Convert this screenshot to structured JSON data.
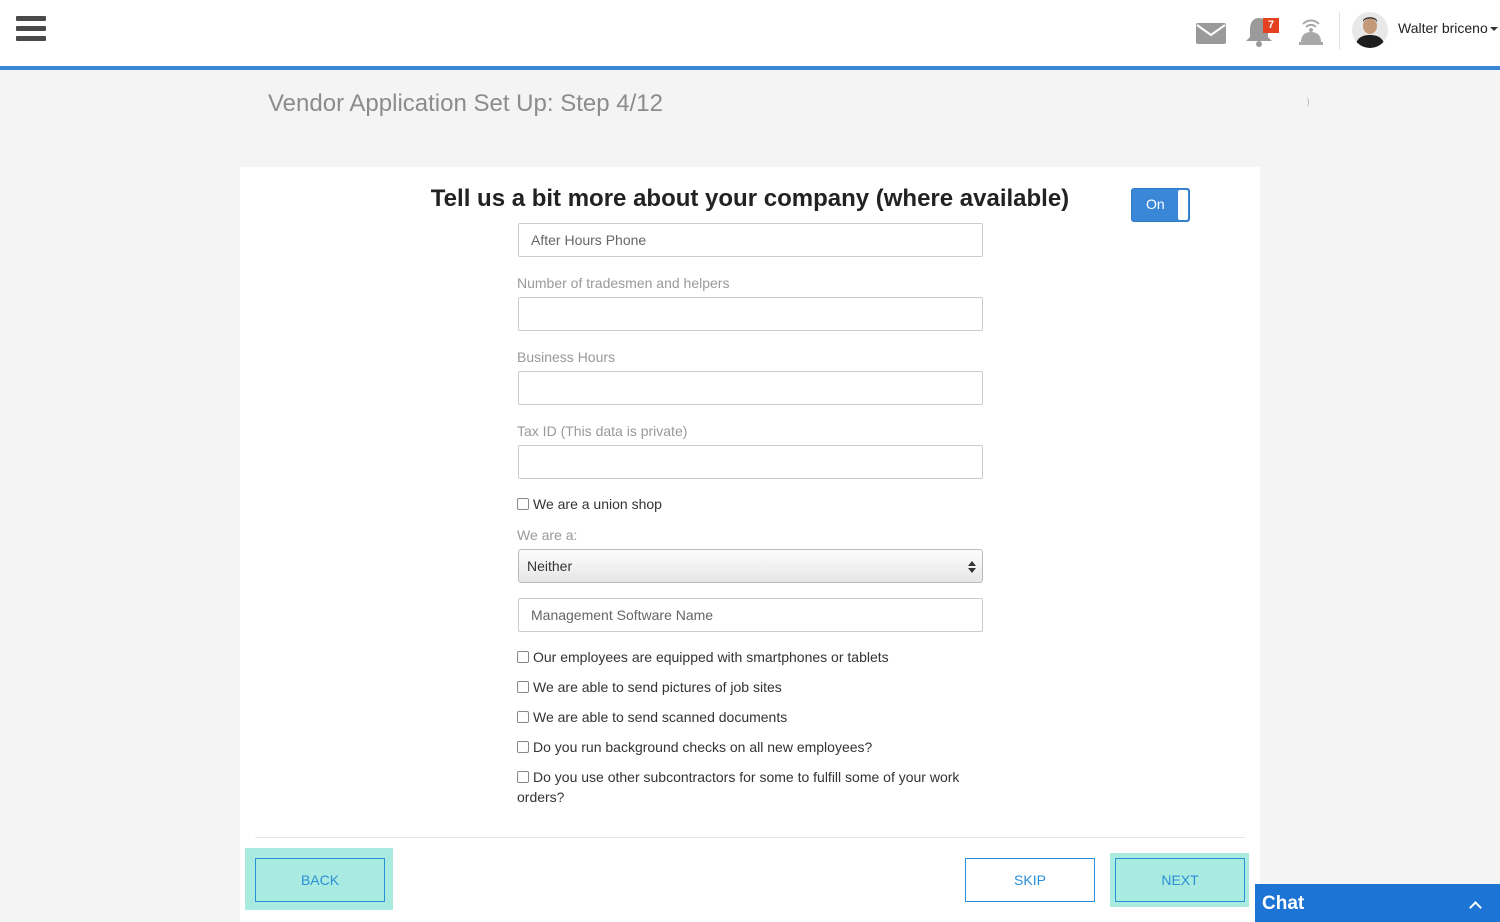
{
  "header": {
    "notification_count": "7",
    "user_name": "Walter briceno",
    "icons": [
      "menu-icon",
      "mail-icon",
      "bell-icon",
      "broadcast-icon",
      "avatar"
    ]
  },
  "page": {
    "title": "Vendor Application Set Up: Step 4/12"
  },
  "form": {
    "heading": "Tell us a bit more about your company (where available)",
    "toggle_label": "On",
    "after_hours_placeholder": "After Hours Phone",
    "tradesmen_label": "Number of tradesmen and helpers",
    "tradesmen_value": "",
    "business_hours_label": "Business Hours",
    "business_hours_value": "",
    "tax_id_label": "Tax ID (This data is private)",
    "tax_id_value": "",
    "union_shop_label": "We are a union shop",
    "we_are_label": "We are a:",
    "we_are_selected": "Neither",
    "management_software_placeholder": "Management Software Name",
    "checkboxes": [
      "Our employees are equipped with smartphones or tablets",
      "We are able to send pictures of job sites",
      "We are able to send scanned documents",
      "Do you run background checks on all new employees?",
      "Do you use other subcontractors for some to fulfill some of your work orders?"
    ]
  },
  "footer": {
    "back_label": "BACK",
    "skip_label": "SKIP",
    "next_label": "NEXT"
  },
  "chat": {
    "label": "Chat"
  },
  "colors": {
    "accent": "#3a87d8",
    "button_text": "#2a8fd8",
    "button_highlight": "#a9ebe0",
    "badge": "#e5401f",
    "chat_bar": "#1c74d4"
  }
}
